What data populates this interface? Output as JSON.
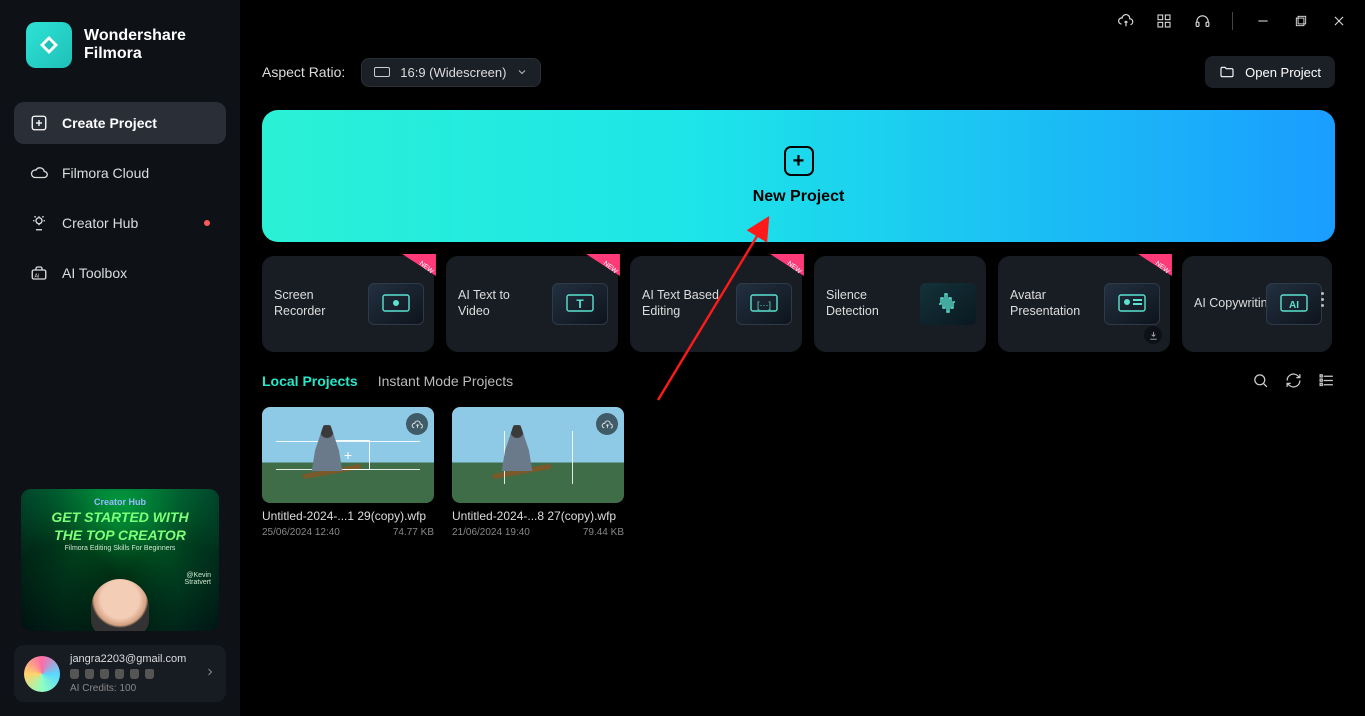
{
  "brand": {
    "line1": "Wondershare",
    "line2": "Filmora"
  },
  "sidebar": {
    "items": [
      {
        "label": "Create Project"
      },
      {
        "label": "Filmora Cloud"
      },
      {
        "label": "Creator Hub"
      },
      {
        "label": "AI Toolbox"
      }
    ]
  },
  "promo": {
    "top": "Creator Hub",
    "title_l1": "GET STARTED WITH",
    "title_l2": "THE TOP CREATOR",
    "subtitle": "Filmora Editing Skills For Beginners",
    "author_handle": "@Kevin",
    "author_name": "Stratvert"
  },
  "account": {
    "email": "jangra2203@gmail.com",
    "credits": "AI Credits: 100"
  },
  "top": {
    "aspect_label": "Aspect Ratio:",
    "aspect_value": "16:9 (Widescreen)",
    "open_project": "Open Project"
  },
  "hero": {
    "label": "New Project"
  },
  "tools": [
    {
      "label": "Screen Recorder",
      "badge_new": true
    },
    {
      "label": "AI Text to Video",
      "badge_new": true
    },
    {
      "label": "AI Text Based Editing",
      "badge_new": true
    },
    {
      "label": "Silence Detection",
      "badge_new": false
    },
    {
      "label": "Avatar Presentation",
      "badge_new": true,
      "download": true
    },
    {
      "label": "AI Copywriting",
      "badge_new": false
    }
  ],
  "tabs": {
    "local": "Local Projects",
    "instant": "Instant Mode Projects"
  },
  "projects": [
    {
      "name": "Untitled-2024-...1 29(copy).wfp",
      "date": "25/06/2024 12:40",
      "size": "74.77 KB"
    },
    {
      "name": "Untitled-2024-...8 27(copy).wfp",
      "date": "21/06/2024 19:40",
      "size": "79.44 KB"
    }
  ]
}
